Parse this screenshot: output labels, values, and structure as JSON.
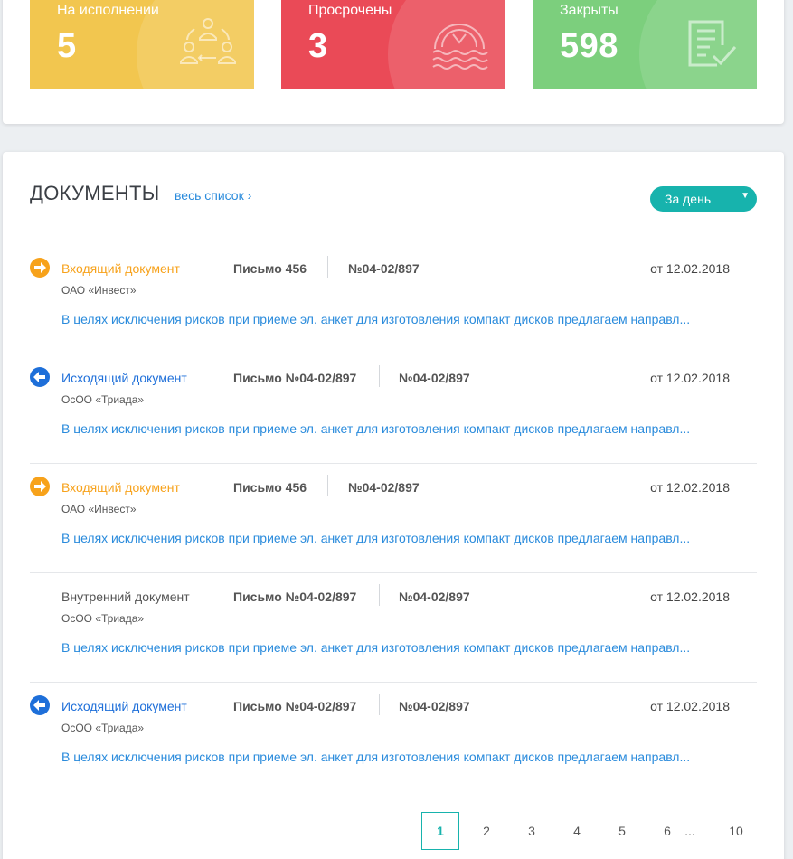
{
  "stats": [
    {
      "label": "На исполнении",
      "value": "5",
      "icon": "workflow-people-icon",
      "color": "#f2c64f"
    },
    {
      "label": "Просрочены",
      "value": "3",
      "icon": "sinking-clock-icon",
      "color": "#ea4a57"
    },
    {
      "label": "Закрыты",
      "value": "598",
      "icon": "document-check-icon",
      "color": "#7ccf7d"
    }
  ],
  "documents": {
    "title": "ДОКУМЕНТЫ",
    "all_link": "весь список ›",
    "period": "За день",
    "items": [
      {
        "type": "Входящий документ",
        "kind": "incoming",
        "letter": "Письмо 456",
        "number": "№04-02/897",
        "date": "от 12.02.2018",
        "org": "ОАО «Инвест»",
        "desc": "В целях исключения рисков при приеме эл. анкет для изготовления компакт дисков предлагаем направл..."
      },
      {
        "type": "Исходящий документ",
        "kind": "outgoing",
        "letter": "Письмо №04-02/897",
        "number": "№04-02/897",
        "date": "от 12.02.2018",
        "org": "ОсОО «Триада»",
        "desc": "В целях исключения рисков при приеме эл. анкет для изготовления компакт дисков предлагаем направл..."
      },
      {
        "type": "Входящий документ",
        "kind": "incoming",
        "letter": "Письмо 456",
        "number": "№04-02/897",
        "date": "от 12.02.2018",
        "org": "ОАО «Инвест»",
        "desc": "В целях исключения рисков при приеме эл. анкет для изготовления компакт дисков предлагаем направл..."
      },
      {
        "type": "Внутренний документ",
        "kind": "internal",
        "letter": "Письмо №04-02/897",
        "number": "№04-02/897",
        "date": "от 12.02.2018",
        "org": "ОсОО «Триада»",
        "desc": "В целях исключения рисков при приеме эл. анкет для изготовления компакт дисков предлагаем направл..."
      },
      {
        "type": "Исходящий документ",
        "kind": "outgoing",
        "letter": "Письмо №04-02/897",
        "number": "№04-02/897",
        "date": "от 12.02.2018",
        "org": "ОсОО «Триада»",
        "desc": "В целях исключения рисков при приеме эл. анкет для изготовления компакт дисков предлагаем направл..."
      }
    ]
  },
  "pagination": {
    "active": "1",
    "pages": [
      "1",
      "2",
      "3",
      "4",
      "5",
      "6",
      "...",
      "10"
    ]
  },
  "colors": {
    "incoming": "#f7a21b",
    "outgoing": "#1e6fd9",
    "internal": "#555555",
    "accent": "#17b3ad",
    "link": "#2a8bdc"
  }
}
